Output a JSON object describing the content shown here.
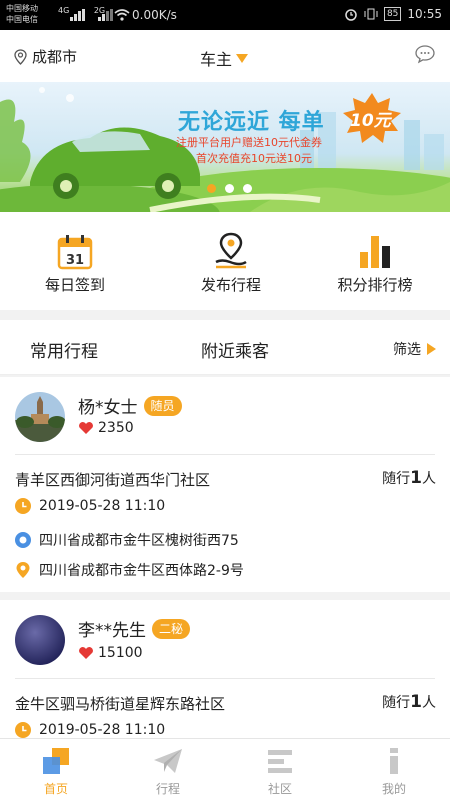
{
  "status_bar": {
    "carrier1": "中国移动",
    "carrier2": "中国电信",
    "net1": "4G",
    "net2": "2G",
    "speed": "0.00K/s",
    "battery": "85",
    "time": "10:55"
  },
  "header": {
    "city": "成都市",
    "role": "车主",
    "icons": {
      "location": "location-pin-icon",
      "message": "chat-bubble-icon"
    }
  },
  "banner": {
    "slogan": "无论远近 每单",
    "price": "10元",
    "promo_line1": "注册平台用户赠送10元代金券",
    "promo_line2": "首次充值充10元送10元",
    "slides": 3,
    "active_slide": 1
  },
  "actions": [
    {
      "label": "每日签到",
      "icon": "calendar-31-icon",
      "calendar_day": "31"
    },
    {
      "label": "发布行程",
      "icon": "map-pin-route-icon"
    },
    {
      "label": "积分排行榜",
      "icon": "bar-chart-icon"
    }
  ],
  "tabs": {
    "common_trips": "常用行程",
    "nearby_passengers": "附近乘客",
    "filter": "筛选"
  },
  "passengers": [
    {
      "name": "杨*女士",
      "badge": "随员",
      "score": "2350",
      "route": "青羊区西御河街道西华门社区",
      "companion_prefix": "随行",
      "companion_count": "1",
      "companion_suffix": "人",
      "datetime": "2019-05-28 11:10",
      "from": "四川省成都市金牛区槐树街西75",
      "to": "四川省成都市金牛区西体路2-9号"
    },
    {
      "name": "李**先生",
      "badge": "二秘",
      "score": "15100",
      "route": "金牛区驷马桥街道星辉东路社区",
      "companion_prefix": "随行",
      "companion_count": "1",
      "companion_suffix": "人",
      "datetime": "2019-05-28 11:10"
    }
  ],
  "nav": [
    {
      "label": "首页",
      "icon": "home-icon",
      "active": true
    },
    {
      "label": "行程",
      "icon": "paper-plane-icon"
    },
    {
      "label": "社区",
      "icon": "community-icon"
    },
    {
      "label": "我的",
      "icon": "profile-icon"
    }
  ],
  "colors": {
    "accent": "#f5a623",
    "heart": "#e53935",
    "start_dot": "#4a90e2",
    "nav_inactive": "#999999"
  }
}
